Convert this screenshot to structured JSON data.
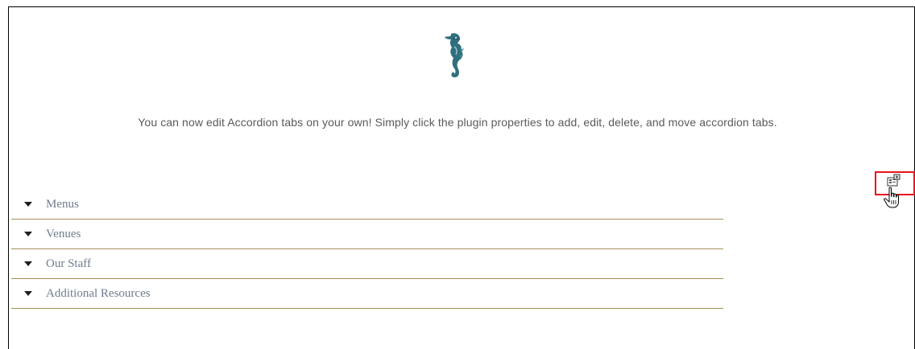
{
  "page": {
    "intro_text": "You can now edit Accordion tabs on your own! Simply click the plugin properties to add, edit, delete, and move accordion tabs."
  },
  "accordion": {
    "items": [
      {
        "label": "Menus"
      },
      {
        "label": "Venues"
      },
      {
        "label": "Our Staff"
      },
      {
        "label": "Additional Resources"
      }
    ]
  },
  "icons": {
    "logo": "seahorse-logo",
    "properties": "plugin-properties-icon",
    "cursor": "hand-pointer-cursor",
    "caret": "caret-down-icon"
  },
  "colors": {
    "highlight": "#e8141e",
    "divider": "#a68e5a",
    "accordion_text": "#6f7c8e",
    "body_text": "#5a5a5a",
    "logo_teal": "#2f6f7f"
  }
}
